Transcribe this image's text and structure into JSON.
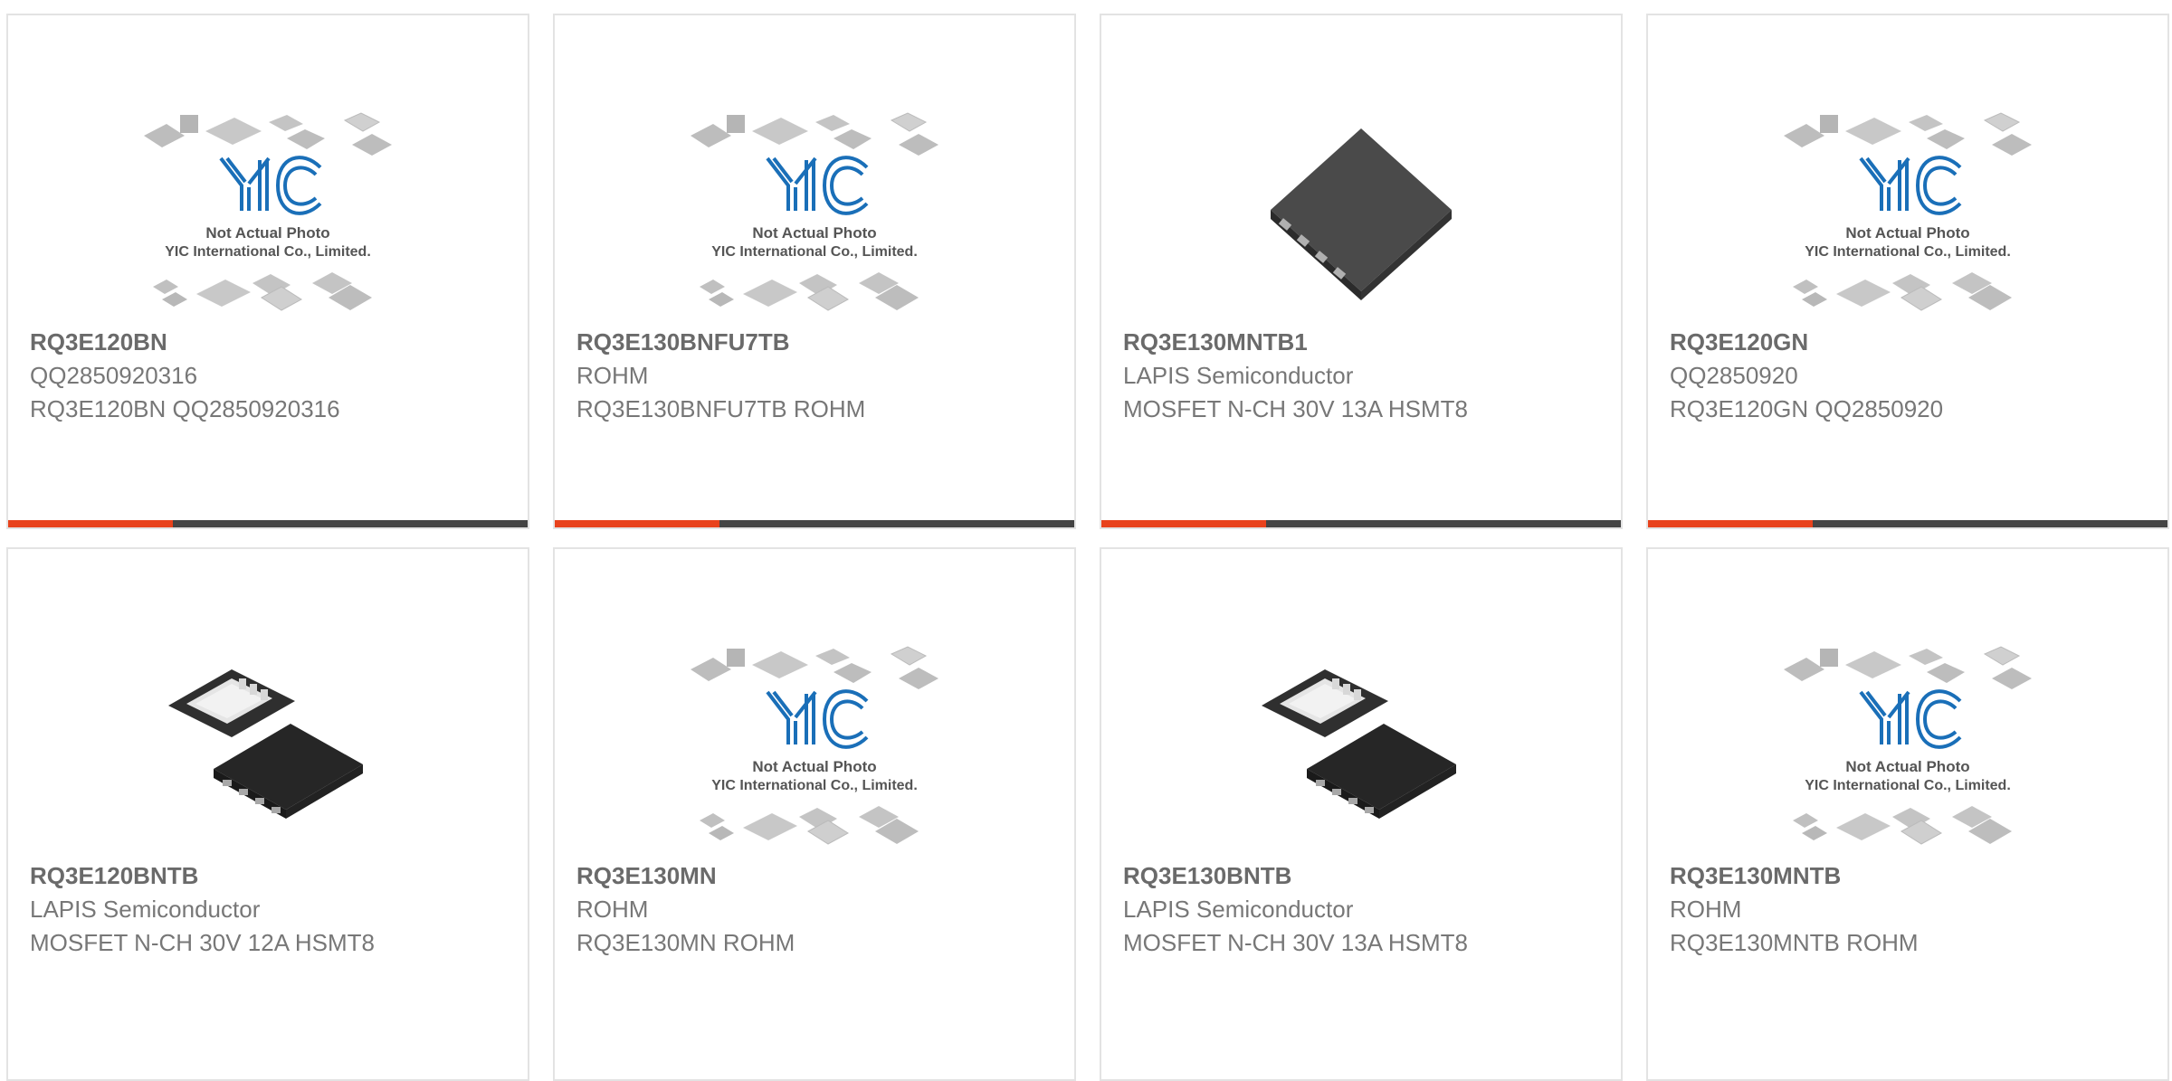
{
  "colors": {
    "accent_bar": "#e8421c",
    "dark_bar": "#444444",
    "logo_blue": "#1a6fb8"
  },
  "placeholder": {
    "line1": "Not Actual Photo",
    "line2": "YIC International Co., Limited.",
    "logo_text": "YIC"
  },
  "products": [
    {
      "part_number": "RQ3E120BN",
      "maker": "QQ2850920316",
      "description": "RQ3E120BN QQ2850920316",
      "image": "placeholder-icon"
    },
    {
      "part_number": "RQ3E130BNFU7TB",
      "maker": "ROHM",
      "description": "RQ3E130BNFU7TB ROHM",
      "image": "placeholder-icon"
    },
    {
      "part_number": "RQ3E130MNTB1",
      "maker": "LAPIS Semiconductor",
      "description": "MOSFET N-CH 30V 13A HSMT8",
      "image": "chip-hsmt8-icon"
    },
    {
      "part_number": "RQ3E120GN",
      "maker": "QQ2850920",
      "description": "RQ3E120GN QQ2850920",
      "image": "placeholder-icon"
    },
    {
      "part_number": "RQ3E120BNTB",
      "maker": "LAPIS Semiconductor",
      "description": "MOSFET N-CH 30V 12A HSMT8",
      "image": "chip-pair-icon"
    },
    {
      "part_number": "RQ3E130MN",
      "maker": "ROHM",
      "description": "RQ3E130MN ROHM",
      "image": "placeholder-icon"
    },
    {
      "part_number": "RQ3E130BNTB",
      "maker": "LAPIS Semiconductor",
      "description": "MOSFET N-CH 30V 13A HSMT8",
      "image": "chip-pair-icon"
    },
    {
      "part_number": "RQ3E130MNTB",
      "maker": "ROHM",
      "description": "RQ3E130MNTB ROHM",
      "image": "placeholder-icon"
    }
  ]
}
